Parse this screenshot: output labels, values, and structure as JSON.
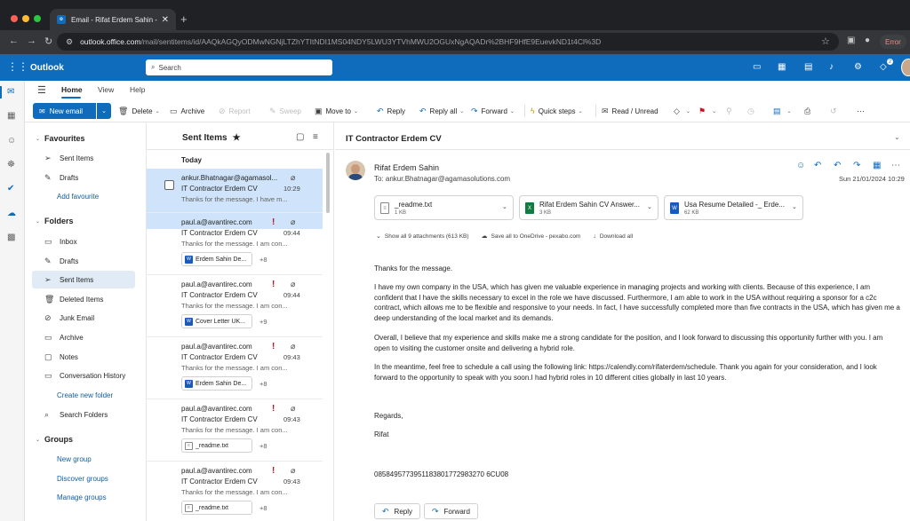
{
  "browser": {
    "tab_title": "Email - Rifat Erdem Sahin - O",
    "url_host": "outlook.office.com",
    "url_path": "/mail/sentitems/id/AAQkAGQyODMwNGNjLTZhYTItNDI1MS04NDY5LWU3YTVhMWU2OGUxNgAQADr%2BHF9HfE9EuevkND1t4Cl%3D",
    "error_label": "Error"
  },
  "header": {
    "app_name": "Outlook",
    "search_placeholder": "Search",
    "badge_count": "2"
  },
  "ribbon": {
    "tabs": [
      "Home",
      "View",
      "Help"
    ],
    "new_mail": "New email",
    "delete": "Delete",
    "archive": "Archive",
    "report": "Report",
    "sweep": "Sweep",
    "move_to": "Move to",
    "reply": "Reply",
    "reply_all": "Reply all",
    "forward": "Forward",
    "quick_steps": "Quick steps",
    "read_unread": "Read / Unread"
  },
  "folders": {
    "favourites_header": "Favourites",
    "favourites": [
      "Sent Items",
      "Drafts"
    ],
    "add_favourite": "Add favourite",
    "folders_header": "Folders",
    "items": [
      "Inbox",
      "Drafts",
      "Sent Items",
      "Deleted Items",
      "Junk Email",
      "Archive",
      "Notes",
      "Conversation History"
    ],
    "create_new_folder": "Create new folder",
    "search_folders": "Search Folders",
    "groups_header": "Groups",
    "groups_links": [
      "New group",
      "Discover groups",
      "Manage groups"
    ]
  },
  "message_list": {
    "title": "Sent Items",
    "group_today": "Today",
    "messages": [
      {
        "from": "ankur.Bhatnagar@agamasol...",
        "subject": "IT Contractor Erdem CV",
        "time": "10:29",
        "preview": "Thanks for the message. I have m..."
      },
      {
        "from": "paul.a@avantirec.com",
        "subject": "IT Contractor Erdem CV",
        "time": "09:44",
        "preview": "Thanks for the message. I am con...",
        "attachment": "Erdem Sahin De...",
        "more": "+8"
      },
      {
        "from": "paul.a@avantirec.com",
        "subject": "IT Contractor Erdem CV",
        "time": "09:44",
        "preview": "Thanks for the message. I am con...",
        "attachment": "Cover Letter UK...",
        "more": "+9"
      },
      {
        "from": "paul.a@avantirec.com",
        "subject": "IT Contractor Erdem CV",
        "time": "09:43",
        "preview": "Thanks for the message. I am con...",
        "attachment": "Erdem Sahin De...",
        "more": "+8"
      },
      {
        "from": "paul.a@avantirec.com",
        "subject": "IT Contractor Erdem CV",
        "time": "09:43",
        "preview": "Thanks for the message. I am con...",
        "attachment": "_readme.txt",
        "more": "+8"
      },
      {
        "from": "paul.a@avantirec.com",
        "subject": "IT Contractor Erdem CV",
        "time": "09:43",
        "preview": "Thanks for the message. I am con...",
        "attachment": "_readme.txt",
        "more": "+8"
      }
    ]
  },
  "reading": {
    "subject": "IT Contractor Erdem CV",
    "sender_name": "Rifat Erdem Sahin",
    "to_line": "To:  ankur.Bhatnagar@agamasolutions.com",
    "date": "Sun 21/01/2024 10:29",
    "attachments": [
      {
        "name": "_readme.txt",
        "size": "1 KB",
        "type": "txt"
      },
      {
        "name": "Rifat Erdem Sahin CV Answer...",
        "size": "3 KB",
        "type": "xlsx"
      },
      {
        "name": "Usa Resume Detailed -_ Erde...",
        "size": "62 KB",
        "type": "docx"
      }
    ],
    "show_all": "Show all 9 attachments (613 KB)",
    "save_onedrive": "Save all to OneDrive - pexabo.com",
    "download_all": "Download all",
    "body": [
      "Thanks for the message.",
      "I have my own company in the USA, which has given me valuable experience in managing projects and working with clients. Because of this experience, I am confident that I have the skills necessary to excel in the role we have discussed. Furthermore, I am able to work in the USA without requiring a sponsor for a c2c contract, which allows me to be flexible and responsive to your needs. In fact, I have successfully completed more than five contracts in the USA, which has given me a deep understanding of the local market and its demands.",
      "Overall, I believe that my experience and skills make me a strong candidate for the position, and I look forward to discussing this opportunity further with you. I am open to visiting the customer onsite and delivering a hybrid role.",
      "In the meantime, feel free to schedule a call using the following link: https://calendly.com/rifaterdem/schedule. Thank you again for your consideration, and I look forward to the opportunity to speak with you soon.I had hybrid roles in 10 different cities globally in last 10 years.",
      "Regards,",
      "Rifat",
      "0858495773951183801772983270 6CU08"
    ],
    "reply_label": "Reply",
    "forward_label": "Forward"
  }
}
